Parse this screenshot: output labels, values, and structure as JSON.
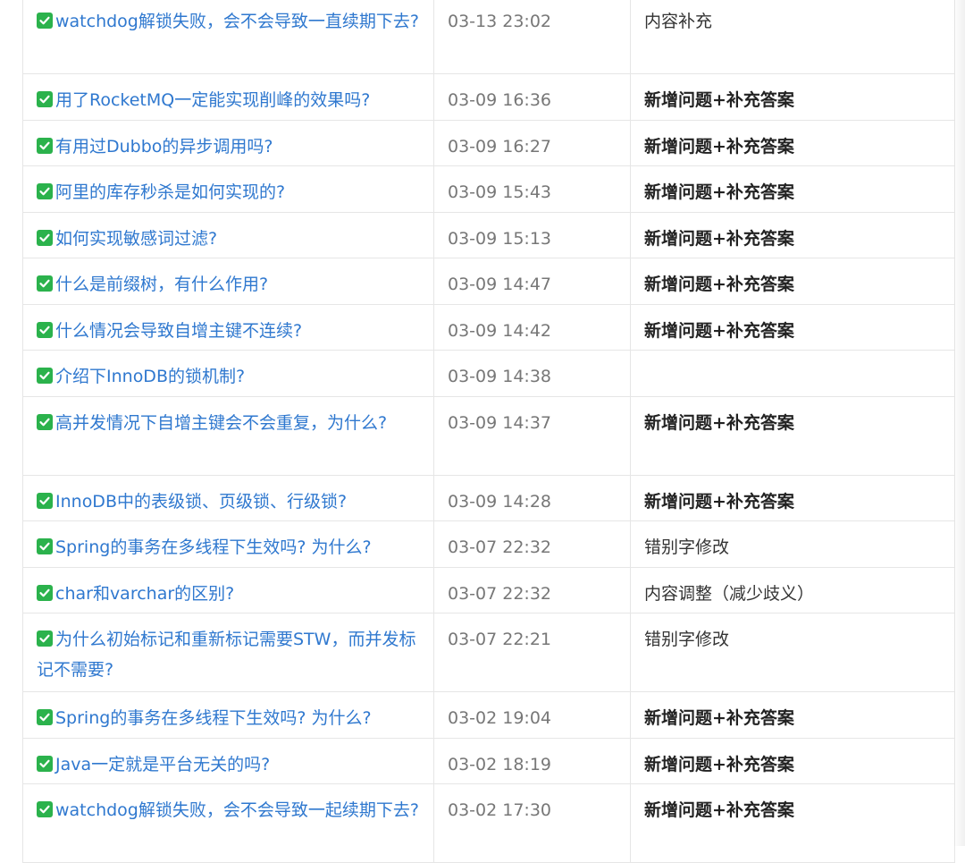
{
  "rows": [
    {
      "title": "watchdog解锁失败，会不会导致一直续期下去?",
      "time": "03-13 23:02",
      "note": "内容补充",
      "note_bold": false,
      "lines": 2
    },
    {
      "title": "用了RocketMQ一定能实现削峰的效果吗?",
      "time": "03-09 16:36",
      "note": "新增问题+补充答案",
      "note_bold": true,
      "lines": 1
    },
    {
      "title": "有用过Dubbo的异步调用吗?",
      "time": "03-09 16:27",
      "note": "新增问题+补充答案",
      "note_bold": true,
      "lines": 1
    },
    {
      "title": "阿里的库存秒杀是如何实现的?",
      "time": "03-09 15:43",
      "note": "新增问题+补充答案",
      "note_bold": true,
      "lines": 1
    },
    {
      "title": "如何实现敏感词过滤?",
      "time": "03-09 15:13",
      "note": "新增问题+补充答案",
      "note_bold": true,
      "lines": 1
    },
    {
      "title": "什么是前缀树，有什么作用?",
      "time": "03-09 14:47",
      "note": "新增问题+补充答案",
      "note_bold": true,
      "lines": 1
    },
    {
      "title": "什么情况会导致自增主键不连续?",
      "time": "03-09 14:42",
      "note": "新增问题+补充答案",
      "note_bold": true,
      "lines": 1
    },
    {
      "title": "介绍下InnoDB的锁机制?",
      "time": "03-09 14:38",
      "note": "",
      "note_bold": false,
      "lines": 1
    },
    {
      "title": "高并发情况下自增主键会不会重复，为什么?",
      "time": "03-09 14:37",
      "note": "新增问题+补充答案",
      "note_bold": true,
      "lines": 2
    },
    {
      "title": "InnoDB中的表级锁、页级锁、行级锁?",
      "time": "03-09 14:28",
      "note": "新增问题+补充答案",
      "note_bold": true,
      "lines": 1
    },
    {
      "title": "Spring的事务在多线程下生效吗? 为什么?",
      "time": "03-07 22:32",
      "note": "错别字修改",
      "note_bold": false,
      "lines": 1
    },
    {
      "title": "char和varchar的区别?",
      "time": "03-07 22:32",
      "note": "内容调整（减少歧义）",
      "note_bold": false,
      "lines": 1
    },
    {
      "title": "为什么初始标记和重新标记需要STW，而并发标记不需要?",
      "time": "03-07 22:21",
      "note": "错别字修改",
      "note_bold": false,
      "lines": 2
    },
    {
      "title": "Spring的事务在多线程下生效吗? 为什么?",
      "time": "03-02 19:04",
      "note": "新增问题+补充答案",
      "note_bold": true,
      "lines": 1
    },
    {
      "title": "Java一定就是平台无关的吗?",
      "time": "03-02 18:19",
      "note": "新增问题+补充答案",
      "note_bold": true,
      "lines": 1
    },
    {
      "title": "watchdog解锁失败，会不会导致一起续期下去?",
      "time": "03-02 17:30",
      "note": "新增问题+补充答案",
      "note_bold": true,
      "lines": 2
    }
  ],
  "icons": {
    "check": "check-box-icon",
    "check_color": "#2bb24c",
    "link_color": "#2f78cf"
  }
}
